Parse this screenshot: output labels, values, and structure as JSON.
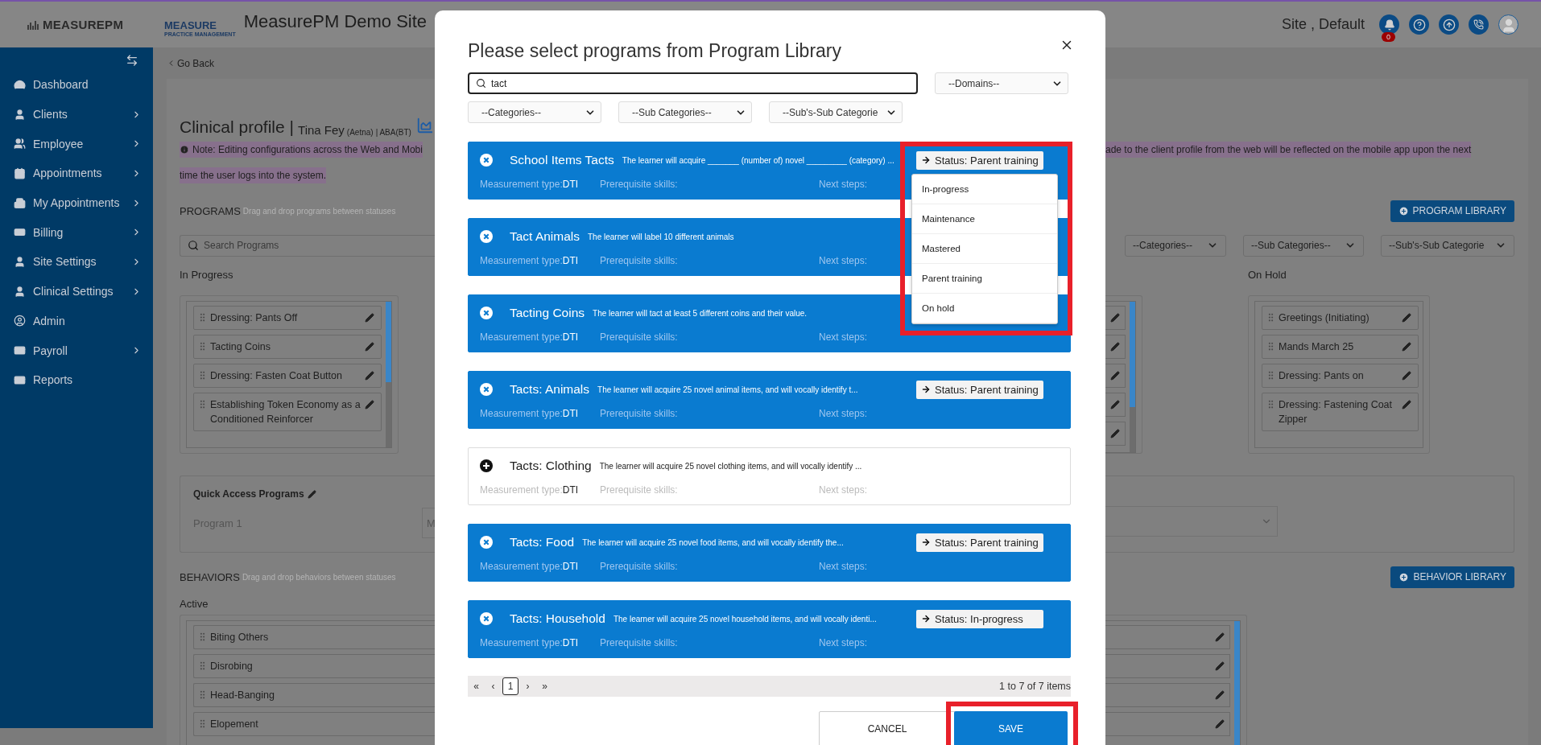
{
  "header": {
    "logo": "MEASUREPM",
    "brand_name": "MEASURE",
    "brand_tagline": "PRACTICE MANAGEMENT",
    "site_title": "MeasurePM Demo Site",
    "site_label": "Site , Default",
    "notifications": "0"
  },
  "sidebar": {
    "items": [
      {
        "label": "Dashboard",
        "has_submenu": false
      },
      {
        "label": "Clients",
        "has_submenu": true
      },
      {
        "label": "Employee",
        "has_submenu": true
      },
      {
        "label": "Appointments",
        "has_submenu": true
      },
      {
        "label": "My Appointments",
        "has_submenu": true
      },
      {
        "label": "Billing",
        "has_submenu": true
      },
      {
        "label": "Site Settings",
        "has_submenu": true
      },
      {
        "label": "Clinical Settings",
        "has_submenu": true
      },
      {
        "label": "Admin",
        "has_submenu": false
      },
      {
        "label": "Payroll",
        "has_submenu": true
      },
      {
        "label": "Reports",
        "has_submenu": false
      }
    ]
  },
  "back_link": "Go Back",
  "profile": {
    "title": "Clinical profile",
    "separator": "|",
    "client": "Tina Fey",
    "payer": "(Aetna)",
    "service": "| ABA(BT)"
  },
  "note": {
    "line_1_start": "Note: Editing configurations across the Web and Mobi",
    "line_1_end": "ade to the client profile from the web will be reflected on the mobile app upon the next",
    "line_2": "time the user logs into the system."
  },
  "programs": {
    "heading": "PROGRAMS",
    "hint": "Drag and drop programs between statuses",
    "search_placeholder": "Search Programs",
    "library_button": "PROGRAM LIBRARY",
    "filters": [
      "--Categories--",
      "--Sub Categories--",
      "--Sub's-Sub Categorie"
    ],
    "in_progress": {
      "title": "In Progress",
      "items": [
        "Dressing: Pants Off",
        "Tacting Coins",
        "Dressing: Fasten Coat Button",
        "Establishing Token Economy as a Conditioned Reinforcer"
      ]
    },
    "on_hold": {
      "title": "On Hold",
      "items": [
        "Greetings (Initiating)",
        "Mands March 25",
        "Dressing: Pants on",
        "Dressing: Fastening Coat Zipper"
      ]
    }
  },
  "quick_access": {
    "title": "Quick Access Programs",
    "label": "Program 1",
    "value": "M"
  },
  "behaviors": {
    "heading": "BEHAVIORS",
    "hint": "Drag and drop behaviors between statuses",
    "library_button": "BEHAVIOR LIBRARY",
    "column_title": "Active",
    "items": [
      "Biting Others",
      "Disrobing",
      "Head-Banging",
      "Elopement"
    ]
  },
  "modal": {
    "title": "Please select programs from Program Library",
    "search_value": "tact",
    "domains": "--Domains--",
    "filters": [
      "--Categories--",
      "--Sub Categories--",
      "--Sub's-Sub Categorie"
    ],
    "programs": [
      {
        "name": "School Items Tacts",
        "description": "The learner will acquire _______ (number of) novel _________ (category) ...",
        "selected": true,
        "highlighted": true,
        "measurement_label": "Measurement type:",
        "measurement": "DTI",
        "prerequisite_label": "Prerequisite skills:",
        "next_label": "Next steps:",
        "status": "Status: Parent training",
        "status_menu": [
          "In-progress",
          "Maintenance",
          "Mastered",
          "Parent training",
          "On hold"
        ]
      },
      {
        "name": "Tact Animals",
        "description": "The learner will label 10 different animals",
        "selected": true,
        "highlighted": false,
        "measurement_label": "Measurement type:",
        "measurement": "DTI",
        "prerequisite_label": "Prerequisite skills:",
        "next_label": "Next steps:"
      },
      {
        "name": "Tacting Coins",
        "description": "The learner will tact at least 5 different coins and their value.",
        "selected": true,
        "highlighted": false,
        "measurement_label": "Measurement type:",
        "measurement": "DTI",
        "prerequisite_label": "Prerequisite skills:",
        "next_label": "Next steps:"
      },
      {
        "name": "Tacts: Animals",
        "description": "The learner will acquire 25 novel animal items, and will vocally identify t...",
        "selected": true,
        "highlighted": false,
        "measurement_label": "Measurement type:",
        "measurement": "DTI",
        "prerequisite_label": "Prerequisite skills:",
        "next_label": "Next steps:",
        "status": "Status: Parent training"
      },
      {
        "name": "Tacts: Clothing",
        "description": "The learner will acquire 25 novel clothing items, and will vocally identify ...",
        "selected": false,
        "highlighted": false,
        "measurement_label": "Measurement type:",
        "measurement": "DTI",
        "prerequisite_label": "Prerequisite skills:",
        "next_label": "Next steps:"
      },
      {
        "name": "Tacts: Food",
        "description": "The learner will acquire 25 novel food items, and will vocally identify the...",
        "selected": true,
        "highlighted": false,
        "measurement_label": "Measurement type:",
        "measurement": "DTI",
        "prerequisite_label": "Prerequisite skills:",
        "next_label": "Next steps:",
        "status": "Status: Parent training"
      },
      {
        "name": "Tacts: Household",
        "description": "The learner will acquire 25 novel household items, and will vocally identi...",
        "selected": true,
        "highlighted": false,
        "measurement_label": "Measurement type:",
        "measurement": "DTI",
        "prerequisite_label": "Prerequisite skills:",
        "next_label": "Next steps:",
        "status": "Status: In-progress"
      }
    ],
    "pagination": {
      "first": "«",
      "prev": "‹",
      "pages": [
        {
          "label": "1",
          "selected": true
        }
      ],
      "next": "›",
      "last": "»",
      "summary": "1 to 7 of 7 items"
    },
    "cancel": "CANCEL",
    "save": "SAVE",
    "save_highlighted": true
  }
}
